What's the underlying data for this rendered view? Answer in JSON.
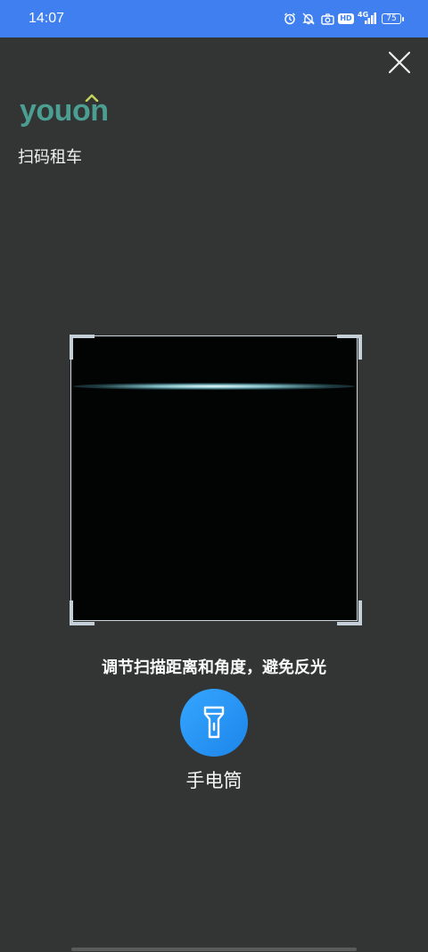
{
  "status_bar": {
    "time": "14:07",
    "icons": [
      "alarm-icon",
      "mute-bell-icon",
      "camera-icon",
      "hd-icon",
      "signal-icon",
      "battery-icon"
    ],
    "hd": "HD",
    "network": "4G",
    "battery": "75",
    "color": "#3f7ff0"
  },
  "header": {
    "logo_text": "youon",
    "subtitle": "扫码租车",
    "brand_color": "#4a9e92"
  },
  "scanner": {
    "hint": "调节扫描距离和角度，避免反光"
  },
  "torch": {
    "label": "手电筒",
    "color": "#1d85ea"
  }
}
